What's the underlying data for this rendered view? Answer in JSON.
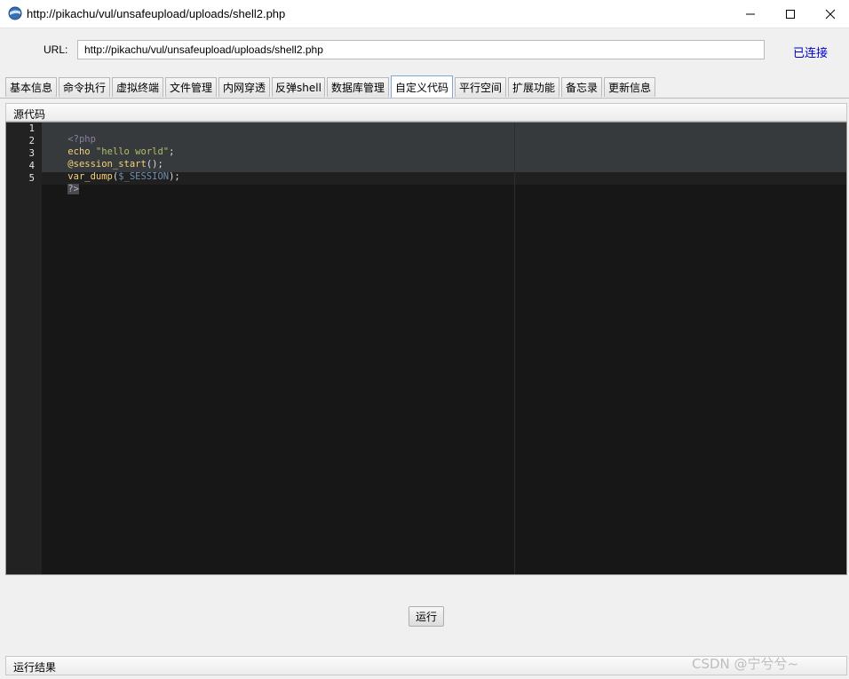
{
  "window": {
    "title": "http://pikachu/vul/unsafeupload/uploads/shell2.php",
    "minimize": "—",
    "maximize": "☐",
    "close": "✕"
  },
  "urlbar": {
    "label": "URL:",
    "value": "http://pikachu/vul/unsafeupload/uploads/shell2.php",
    "status": "已连接"
  },
  "tabs": [
    {
      "label": "基本信息"
    },
    {
      "label": "命令执行"
    },
    {
      "label": "虚拟终端"
    },
    {
      "label": "文件管理"
    },
    {
      "label": "内网穿透"
    },
    {
      "label": "反弹shell"
    },
    {
      "label": "数据库管理"
    },
    {
      "label": "自定义代码",
      "active": true
    },
    {
      "label": "平行空间"
    },
    {
      "label": "扩展功能"
    },
    {
      "label": "备忘录"
    },
    {
      "label": "更新信息"
    }
  ],
  "source_panel": {
    "title": "源代码"
  },
  "editor": {
    "line_numbers": [
      "1",
      "2",
      "3",
      "4",
      "5"
    ],
    "lines": [
      {
        "tokens": [
          {
            "text": "<?php",
            "color": "#8a7fa0"
          }
        ]
      },
      {
        "tokens": [
          {
            "text": "echo",
            "color": "#f2d27a"
          },
          {
            "text": " ",
            "color": "#ddd"
          },
          {
            "text": "\"hello world\"",
            "color": "#b5bd68"
          },
          {
            "text": ";",
            "color": "#ddd"
          }
        ]
      },
      {
        "tokens": [
          {
            "text": "@session_start",
            "color": "#f2d27a"
          },
          {
            "text": "();",
            "color": "#ddd"
          }
        ]
      },
      {
        "tokens": [
          {
            "text": "var_dump",
            "color": "#f2d27a"
          },
          {
            "text": "(",
            "color": "#ddd"
          },
          {
            "text": "$_SESSION",
            "color": "#6f8fb0"
          },
          {
            "text": ");",
            "color": "#ddd"
          }
        ]
      },
      {
        "tokens": [
          {
            "text": "?>",
            "color": "#b0b0d8"
          }
        ]
      }
    ]
  },
  "run_button": {
    "label": "运行"
  },
  "result_panel": {
    "title": "运行结果"
  },
  "watermark": "CSDN @宁兮兮~",
  "colors": {
    "status_link": "#0000cc",
    "editor_bg": "#171717",
    "selection": "#363a3d"
  }
}
